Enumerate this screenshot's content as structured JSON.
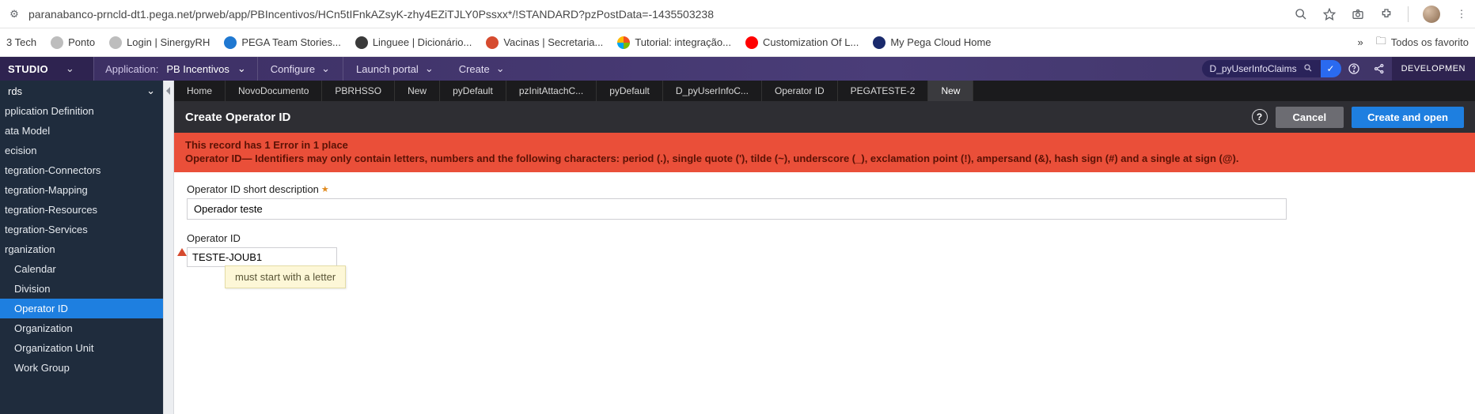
{
  "browser": {
    "url": "paranabanco-prncld-dt1.pega.net/prweb/app/PBIncentivos/HCn5tIFnkAZsyK-zhy4EZiTJLY0Pssxx*/!STANDARD?pzPostData=-1435503238",
    "overflow_label": "Todos os favorito"
  },
  "bookmarks": [
    {
      "label": "3 Tech"
    },
    {
      "label": "Ponto"
    },
    {
      "label": "Login | SinergyRH"
    },
    {
      "label": "PEGA Team Stories..."
    },
    {
      "label": "Linguee | Dicionário..."
    },
    {
      "label": "Vacinas | Secretaria..."
    },
    {
      "label": "Tutorial: integração..."
    },
    {
      "label": "Customization Of L..."
    },
    {
      "label": "My Pega Cloud Home"
    }
  ],
  "pegaTop": {
    "studio": "STUDIO",
    "application_label": "Application:",
    "application_name": "PB Incentivos",
    "menus": [
      "Configure",
      "Launch portal",
      "Create"
    ],
    "search_value": "D_pyUserInfoClaims",
    "dev_label": "DEVELOPMEN"
  },
  "sidebar": {
    "header": "rds",
    "items": [
      "pplication Definition",
      "ata Model",
      "ecision",
      "tegration-Connectors",
      "tegration-Mapping",
      "tegration-Resources",
      "tegration-Services",
      "rganization"
    ],
    "subitems": [
      "Calendar",
      "Division",
      "Operator ID",
      "Organization",
      "Organization Unit",
      "Work Group"
    ],
    "active_sub": "Operator ID"
  },
  "tabs": [
    "Home",
    "NovoDocumento",
    "PBRHSSO",
    "New",
    "pyDefault",
    "pzInitAttachC...",
    "pyDefault",
    "D_pyUserInfoC...",
    "Operator ID",
    "PEGATESTE-2",
    "New"
  ],
  "tabs_active_index": 10,
  "ruleHeader": {
    "title": "Create Operator ID",
    "cancel": "Cancel",
    "createOpen": "Create and open"
  },
  "errorBanner": {
    "line1": "This record has 1 Error in 1 place",
    "line2": "Operator ID— Identifiers may only contain letters, numbers and the following characters: period (.), single quote ('), tilde (~), underscore (_), exclamation point (!), ampersand (&), hash sign (#) and a single at sign (@)."
  },
  "form": {
    "shortDescLabel": "Operator ID short description",
    "shortDescValue": "Operador teste",
    "opIdLabel": "Operator ID",
    "opIdValue": "TESTE-JOUB1",
    "opIdError": "must start with a letter"
  }
}
